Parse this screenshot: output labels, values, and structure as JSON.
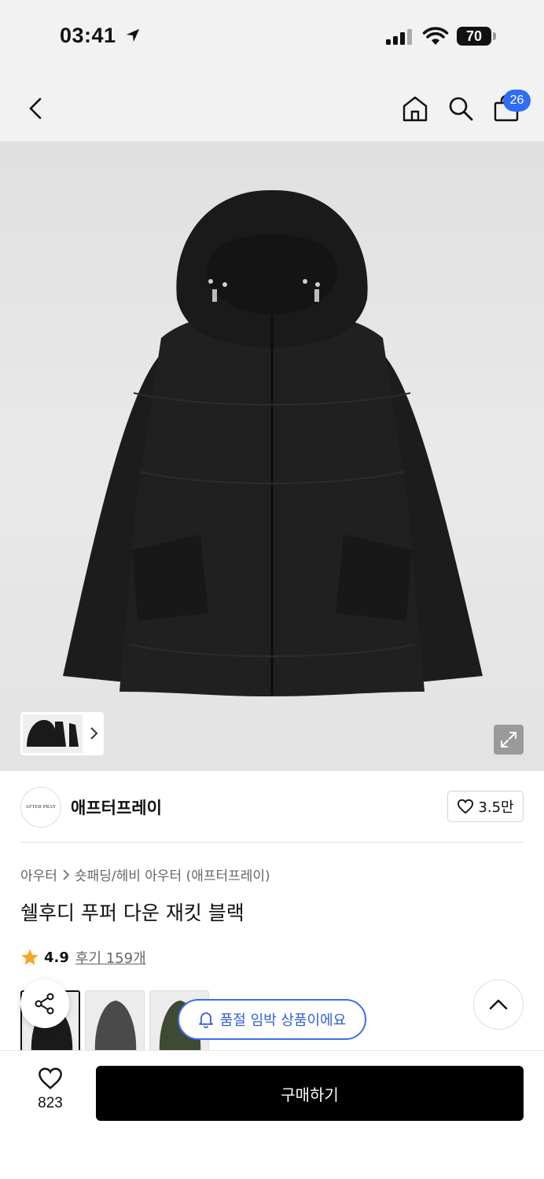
{
  "status_bar": {
    "time": "03:41",
    "battery": "70"
  },
  "nav": {
    "cart_count": "26"
  },
  "brand": {
    "name": "애프터프레이",
    "logo_text": "AFTER PRAY",
    "likes": "3.5만"
  },
  "breadcrumb": {
    "category": "아우터",
    "subcategory": "숏패딩/헤비 아우터 (애프터프레이)"
  },
  "product": {
    "title": "쉘후디 푸퍼 다운 재킷 블랙",
    "rating": "4.9",
    "reviews_label": "후기 159개"
  },
  "colors": [
    {
      "name": "black",
      "color": "#1a1a1a"
    },
    {
      "name": "charcoal",
      "color": "#4a4a4a"
    },
    {
      "name": "khaki",
      "color": "#3f4a35"
    }
  ],
  "toast": {
    "text": "품절 임박 상품이에요"
  },
  "bottom": {
    "wish_count": "823",
    "buy_label": "구매하기"
  },
  "theme": {
    "accent": "#2f6df6",
    "star": "#f5a623"
  }
}
